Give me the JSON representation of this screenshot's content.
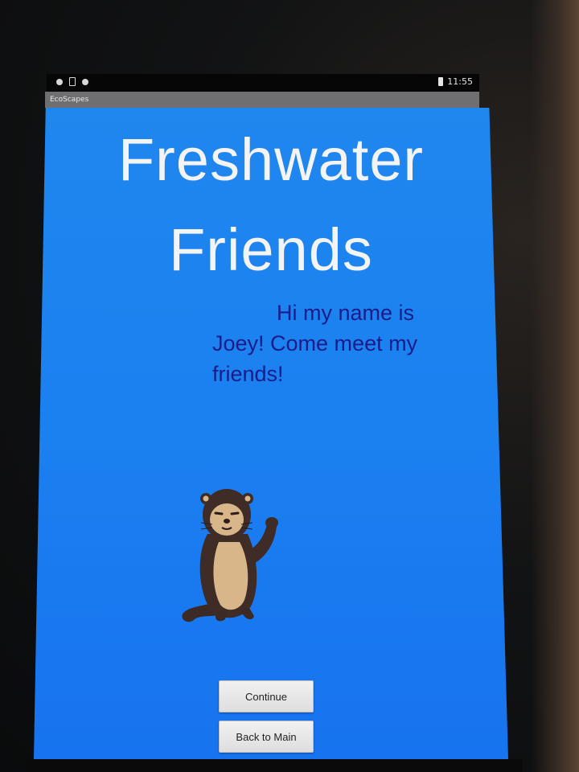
{
  "status_bar": {
    "time": "11:55",
    "icons": [
      "notification-dot-icon",
      "sim-card-icon",
      "notification-dot-icon",
      "battery-icon"
    ]
  },
  "action_bar": {
    "app_title": "EcoScapes"
  },
  "main": {
    "title_line1": "Freshwater",
    "title_line2": "Friends",
    "speech_line1": "Hi my name is",
    "speech_line2": "Joey! Come meet my",
    "speech_line3": "friends!",
    "mascot_icon": "otter-illustration"
  },
  "buttons": {
    "continue_label": "Continue",
    "back_label": "Back to Main"
  },
  "colors": {
    "background_blue": "#1b80f0",
    "title_text": "#f4f4f4",
    "speech_text": "#1b1b8a",
    "action_bar": "#6f6f71"
  }
}
